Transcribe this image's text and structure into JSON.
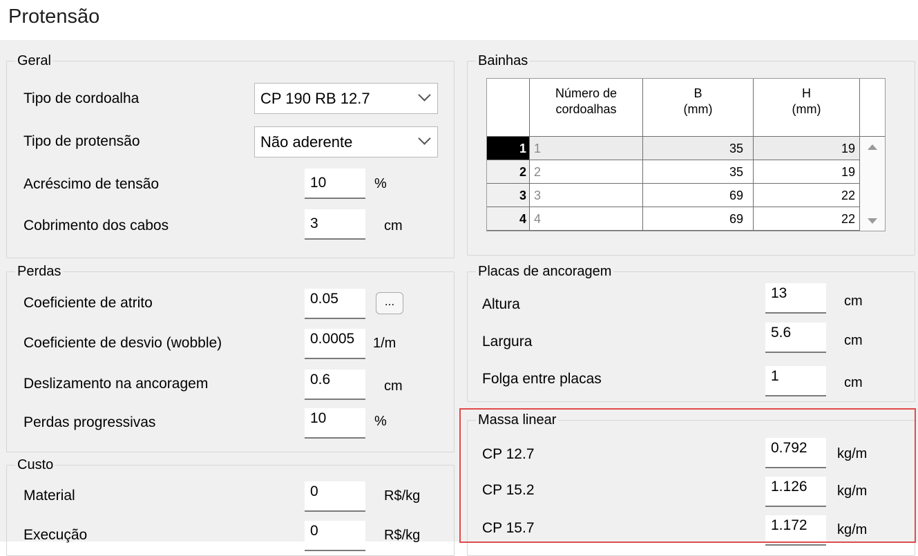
{
  "window": {
    "title": "Protensão"
  },
  "geral": {
    "legend": "Geral",
    "tipo_cordoalha": {
      "label": "Tipo de cordoalha",
      "value": "CP 190 RB 12.7"
    },
    "tipo_protensao": {
      "label": "Tipo de protensão",
      "value": "Não aderente"
    },
    "acrescimo": {
      "label": "Acréscimo de tensão",
      "value": "10",
      "unit": "%"
    },
    "cobrimento": {
      "label": "Cobrimento dos cabos",
      "value": "3",
      "unit": "cm"
    }
  },
  "perdas": {
    "legend": "Perdas",
    "atrito": {
      "label": "Coeficiente de atrito",
      "value": "0.05",
      "button": "..."
    },
    "wobble": {
      "label": "Coeficiente de desvio (wobble)",
      "value": "0.0005",
      "unit": "1/m"
    },
    "deslizamento": {
      "label": "Deslizamento na ancoragem",
      "value": "0.6",
      "unit": "cm"
    },
    "progressivas": {
      "label": "Perdas progressivas",
      "value": "10",
      "unit": "%"
    }
  },
  "custo": {
    "legend": "Custo",
    "material": {
      "label": "Material",
      "value": "0",
      "unit": "R$/kg"
    },
    "execucao": {
      "label": "Execução",
      "value": "0",
      "unit": "R$/kg"
    }
  },
  "bainhas": {
    "legend": "Bainhas",
    "headers": {
      "num_line1": "Número de",
      "num_line2": "cordoalhas",
      "b_line1": "B",
      "b_line2": "(mm)",
      "h_line1": "H",
      "h_line2": "(mm)"
    },
    "rows": [
      {
        "idx": "1",
        "num": "1",
        "b": "35",
        "h": "19"
      },
      {
        "idx": "2",
        "num": "2",
        "b": "35",
        "h": "19"
      },
      {
        "idx": "3",
        "num": "3",
        "b": "69",
        "h": "22"
      },
      {
        "idx": "4",
        "num": "4",
        "b": "69",
        "h": "22"
      }
    ]
  },
  "placas": {
    "legend": "Placas de ancoragem",
    "altura": {
      "label": "Altura",
      "value": "13",
      "unit": "cm"
    },
    "largura": {
      "label": "Largura",
      "value": "5.6",
      "unit": "cm"
    },
    "folga": {
      "label": "Folga entre placas",
      "value": "1",
      "unit": "cm"
    }
  },
  "massa": {
    "legend": "Massa linear",
    "cp127": {
      "label": "CP 12.7",
      "value": "0.792",
      "unit": "kg/m"
    },
    "cp152": {
      "label": "CP 15.2",
      "value": "1.126",
      "unit": "kg/m"
    },
    "cp157": {
      "label": "CP 15.7",
      "value": "1.172",
      "unit": "kg/m"
    }
  },
  "colors": {
    "highlight": "#e04a4a",
    "dialog_bg": "#f0f0f0"
  }
}
